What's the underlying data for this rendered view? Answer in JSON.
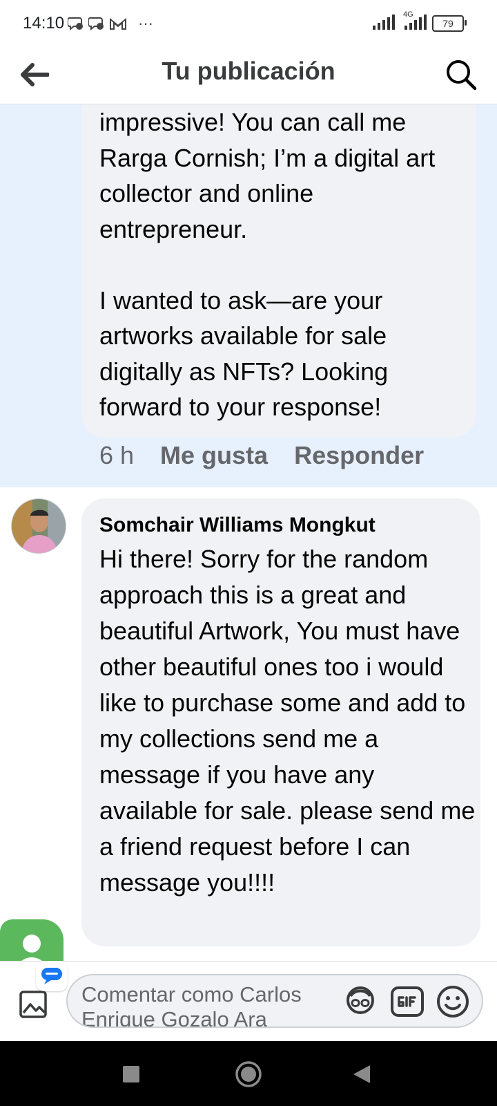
{
  "status_bar": {
    "time": "14:10",
    "network": "4G",
    "battery": "79",
    "more": "···"
  },
  "header": {
    "title": "Tu publicación"
  },
  "comment_1": {
    "text": "impressive! You can call me\nRarga Cornish; I’m a digital art\ncollector and online\nentrepreneur.\n\nI wanted to ask—are your\nartworks available for sale\ndigitally as NFTs? Looking\nforward to your response!",
    "time": "6 h",
    "like_label": "Me gusta",
    "reply_label": "Responder"
  },
  "comment_2": {
    "author": "Somchair Williams Mongkut",
    "text": "Hi there! Sorry for the random approach this is a great and beautiful Artwork, You must have other beautiful ones too i would like to purchase some and add to my collections send me a message if you have any available for sale. please send me a friend request before I can message you!!!!"
  },
  "composer": {
    "placeholder": "Comentar como Carlos Enrique Gozalo Ara"
  },
  "colors": {
    "highlight": "#e7f0fd",
    "bubble": "#f0f2f5",
    "secondary_text": "#65676b",
    "chat_head": "#5cb85c"
  },
  "icons": [
    "message-icon",
    "gmail-icon",
    "signal-icon",
    "battery-icon",
    "back-arrow-icon",
    "search-icon",
    "chat-head-icon",
    "photo-icon",
    "avatar-sticker-icon",
    "gif-icon",
    "emoji-icon",
    "square-nav-icon",
    "home-nav-icon",
    "back-nav-icon"
  ]
}
